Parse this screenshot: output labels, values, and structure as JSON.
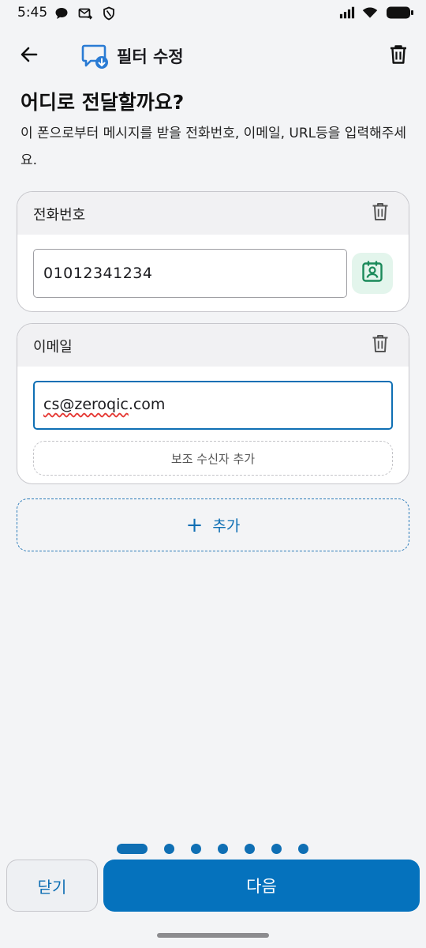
{
  "status_bar": {
    "time": "5:45",
    "left_icons": [
      "chat-bubble-icon",
      "mail-arrow-icon",
      "shield-icon"
    ],
    "right_icons": [
      "cellular-signal-icon",
      "wifi-icon",
      "battery-icon"
    ]
  },
  "app_bar": {
    "title": "필터 수정",
    "title_icon": "message-download-icon",
    "back_icon": "arrow-back-icon",
    "delete_icon": "trash-icon"
  },
  "main": {
    "heading": "어디로 전달할까요?",
    "description": "이 폰으로부터 메시지를 받을 전화번호, 이메일, URL등을 입력해주세요."
  },
  "cards": {
    "phone": {
      "label": "전화번호",
      "value": "01012341234",
      "contact_icon": "contact-card-icon"
    },
    "email": {
      "label": "이메일",
      "value_misspelled": "cs@zeroqic",
      "value_rest": ".com",
      "add_sub_recipient_label": "보조 수신자 추가"
    }
  },
  "add_button": {
    "plus": "+",
    "label": "추가"
  },
  "pager": {
    "total": 7,
    "current": 1
  },
  "footer": {
    "close_label": "닫기",
    "next_label": "다음"
  },
  "colors": {
    "accent": "#0572bd",
    "background": "#f3f4f6",
    "contact_button_bg": "#e3f5ec",
    "contact_icon": "#1b8a5a"
  }
}
